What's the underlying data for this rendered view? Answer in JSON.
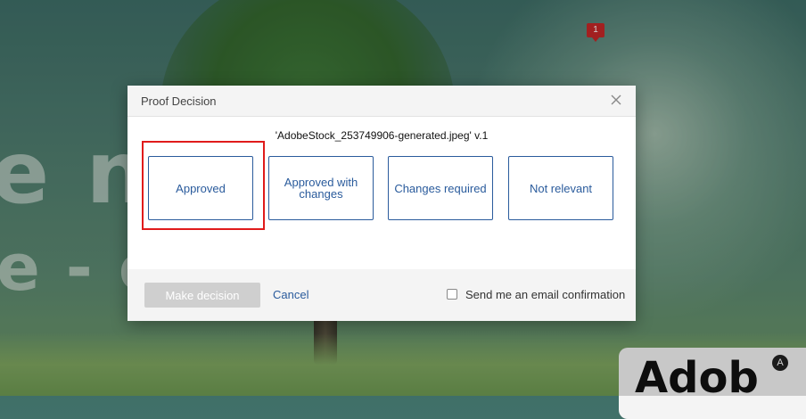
{
  "background": {
    "line1": "e n    oike",
    "line2": "e - e          nce",
    "notification_count": "1",
    "logo_text": "Adob"
  },
  "dialog": {
    "title": "Proof Decision",
    "file_name": "'AdobeStock_253749906-generated.jpeg' v.1",
    "choices": [
      {
        "label": "Approved",
        "selected": true
      },
      {
        "label": "Approved with changes",
        "selected": false
      },
      {
        "label": "Changes required",
        "selected": false
      },
      {
        "label": "Not relevant",
        "selected": false
      }
    ],
    "make_decision_label": "Make decision",
    "cancel_label": "Cancel",
    "email_confirmation_label": "Send me an email confirmation",
    "email_confirmation_checked": false
  },
  "colors": {
    "accent": "#2a5b9c",
    "highlight": "#e01b1b",
    "disabled_button": "#cfcfcf"
  },
  "icons": {
    "close": "close-icon",
    "checkbox": "checkbox-icon"
  }
}
